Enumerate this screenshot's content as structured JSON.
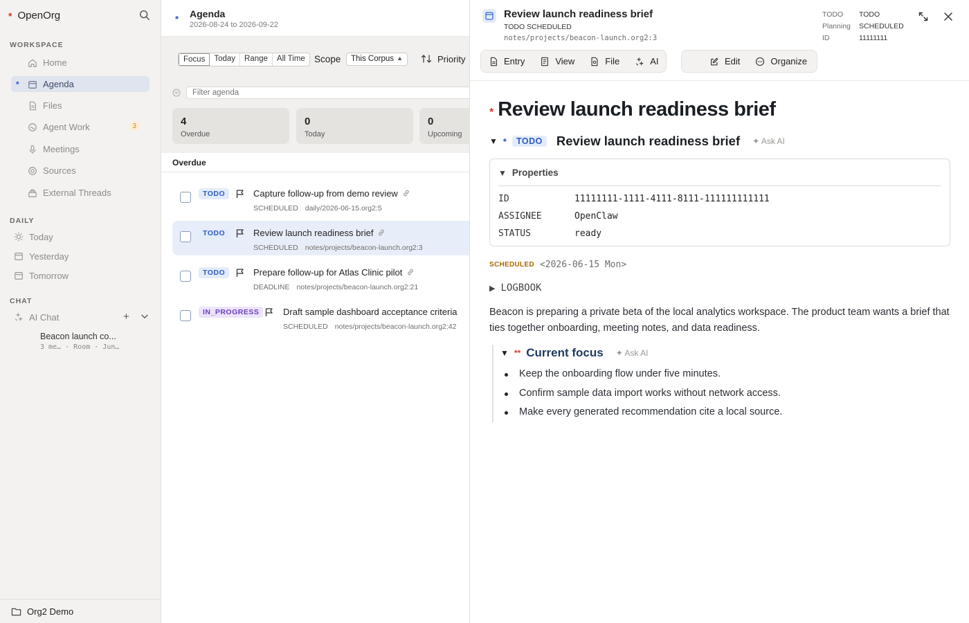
{
  "app": {
    "name": "OpenOrg"
  },
  "sidebar": {
    "workspace_label": "WORKSPACE",
    "items": [
      {
        "label": "Home",
        "icon": "home-icon"
      },
      {
        "label": "Agenda",
        "icon": "calendar-icon",
        "active": true
      },
      {
        "label": "Files",
        "icon": "file-icon"
      },
      {
        "label": "Agent Work",
        "icon": "agent-icon",
        "badge": "3"
      },
      {
        "label": "Meetings",
        "icon": "mic-icon"
      },
      {
        "label": "Sources",
        "icon": "sources-icon"
      },
      {
        "label": "External Threads",
        "icon": "threads-icon"
      }
    ],
    "daily_label": "DAILY",
    "daily": [
      {
        "label": "Today",
        "icon": "sun-icon"
      },
      {
        "label": "Yesterday",
        "icon": "calendar-icon"
      },
      {
        "label": "Tomorrow",
        "icon": "calendar-icon"
      }
    ],
    "chat_label": "CHAT",
    "chat": {
      "label": "AI Chat",
      "add": "+",
      "thread_title": "Beacon launch co...",
      "thread_meta": "3 me… · Room · Jun…"
    },
    "footer": "Org2 Demo"
  },
  "agenda": {
    "title": "Agenda",
    "range": "2026-08-24 to 2026-09-22",
    "modes": [
      "Focus",
      "Today",
      "Range",
      "All Time"
    ],
    "active_mode": "Focus",
    "scope_label": "Scope",
    "scope_value": "This Corpus",
    "sort_label": "Priority",
    "filter_placeholder": "Filter agenda",
    "stats": [
      {
        "num": "4",
        "label": "Overdue"
      },
      {
        "num": "0",
        "label": "Today"
      },
      {
        "num": "0",
        "label": "Upcoming"
      }
    ],
    "section": "Overdue",
    "rows": [
      {
        "keyword": "TODO",
        "title": "Capture follow-up from demo review",
        "kind": "SCHEDULED",
        "path": "daily/2026-06-15.org2:5"
      },
      {
        "keyword": "TODO",
        "title": "Review launch readiness brief",
        "kind": "SCHEDULED",
        "path": "notes/projects/beacon-launch.org2:3",
        "selected": true
      },
      {
        "keyword": "TODO",
        "title": "Prepare follow-up for Atlas Clinic pilot",
        "kind": "DEADLINE",
        "path": "notes/projects/beacon-launch.org2:21"
      },
      {
        "keyword": "IN_PROGRESS",
        "title": "Draft sample dashboard acceptance criteria",
        "kind": "SCHEDULED",
        "path": "notes/projects/beacon-launch.org2:42"
      }
    ]
  },
  "detail": {
    "header_title": "Review launch readiness brief",
    "header_sub": "TODO SCHEDULED",
    "header_path": "notes/projects/beacon-launch.org2:3",
    "meta": [
      {
        "k": "TODO",
        "v": "TODO"
      },
      {
        "k": "Planning",
        "v": "SCHEDULED"
      },
      {
        "k": "ID",
        "v": "11111111"
      }
    ],
    "tabs1": [
      "Entry",
      "View",
      "File",
      "AI"
    ],
    "tabs2": [
      "Edit",
      "Organize"
    ],
    "doc_title": "Review launch readiness brief",
    "heading": {
      "keyword": "TODO",
      "text": "Review launch readiness brief",
      "ask": "✦ Ask AI"
    },
    "properties_label": "Properties",
    "properties": [
      {
        "k": "ID",
        "v": "11111111-1111-4111-8111-111111111111"
      },
      {
        "k": "ASSIGNEE",
        "v": "OpenClaw"
      },
      {
        "k": "STATUS",
        "v": "ready"
      }
    ],
    "scheduled_key": "SCHEDULED",
    "scheduled_value": "<2026-06-15 Mon>",
    "logbook": "LOGBOOK",
    "paragraph": "Beacon is preparing a private beta of the local analytics workspace. The product team wants a brief that ties together onboarding, meeting notes, and data readiness.",
    "subheading": {
      "text": "Current focus",
      "ask": "✦ Ask AI"
    },
    "bullets": [
      "Keep the onboarding flow under five minutes.",
      "Confirm sample data import works without network access.",
      "Make every generated recommendation cite a local source."
    ]
  }
}
